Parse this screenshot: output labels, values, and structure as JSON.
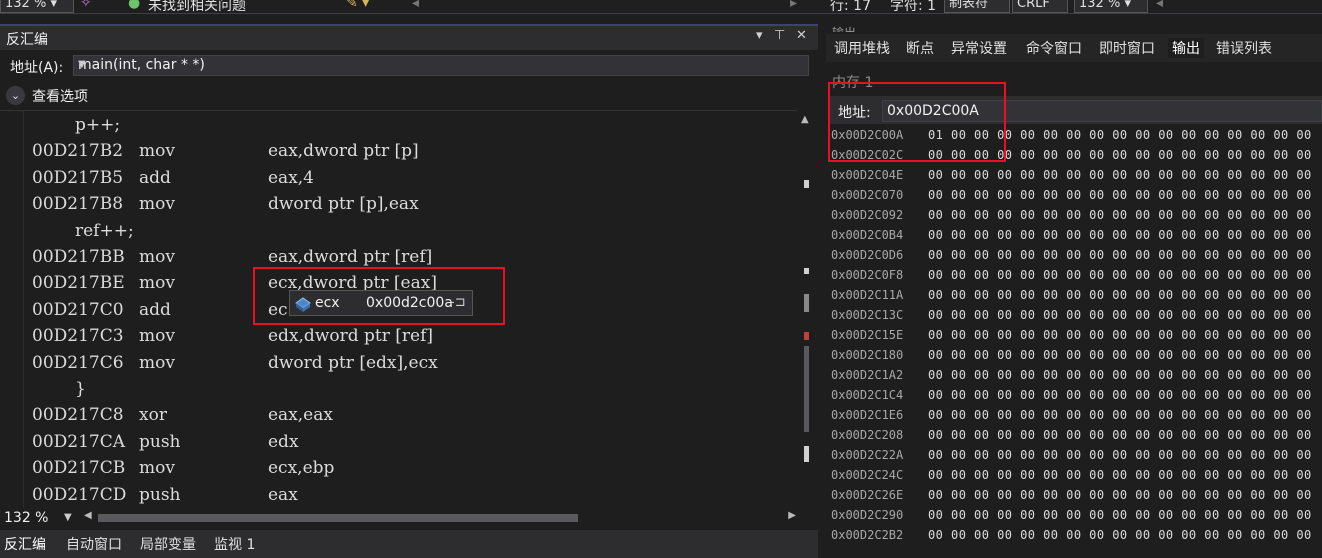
{
  "topbar": {
    "zoom": "132 %",
    "status": "未找到相关问题",
    "line": "行: 17",
    "char": "字符: 1",
    "tabs": "制表符",
    "eol": "CRLF",
    "zoom_right": "132 %"
  },
  "disasm": {
    "title": "反汇编",
    "address_label": "地址(A):",
    "address_value": "main(int, char * *)",
    "view_options": "查看选项",
    "tooltip": {
      "name": "ecx",
      "value": "0x00d2c00a"
    },
    "zoom": "132 %"
  },
  "code_lines": [
    {
      "src": "p++;"
    },
    {
      "addr": "00D217B2",
      "mn": "mov",
      "op": "eax,dword ptr [p]"
    },
    {
      "addr": "00D217B5",
      "mn": "add",
      "op": "eax,4"
    },
    {
      "addr": "00D217B8",
      "mn": "mov",
      "op": "dword ptr [p],eax"
    },
    {
      "src": "ref++;"
    },
    {
      "addr": "00D217BB",
      "mn": "mov",
      "op": "eax,dword ptr [ref]"
    },
    {
      "addr": "00D217BE",
      "mn": "mov",
      "op": "ecx,dword ptr [eax]"
    },
    {
      "addr": "00D217C0",
      "mn": "add",
      "op": "ec"
    },
    {
      "addr": "00D217C3",
      "mn": "mov",
      "op": "edx,dword ptr [ref]"
    },
    {
      "addr": "00D217C6",
      "mn": "mov",
      "op": "dword ptr [edx],ecx"
    },
    {
      "src": "}"
    },
    {
      "addr": "00D217C8",
      "mn": "xor",
      "op": "eax,eax"
    },
    {
      "addr": "00D217CA",
      "mn": "push",
      "op": "edx"
    },
    {
      "addr": "00D217CB",
      "mn": "mov",
      "op": "ecx,ebp"
    },
    {
      "addr": "00D217CD",
      "mn": "push",
      "op": "eax"
    }
  ],
  "bottom_tabs": [
    "反汇编",
    "自动窗口",
    "局部变量",
    "监视 1"
  ],
  "right_tabs": [
    "调用堆栈",
    "断点",
    "异常设置",
    "命令窗口",
    "即时窗口",
    "输出",
    "错误列表"
  ],
  "right_header_partial": "输出",
  "memory": {
    "title": "内存 1",
    "address_label": "地址:",
    "address_value": "0x00D2C00A",
    "first_row_bytes": "01 00 00 00 00 00 00 00 00 00 00 00 00 00 00 00 00",
    "zero_bytes": "00 00 00 00 00 00 00 00 00 00 00 00 00 00 00 00 00",
    "rows": [
      "0x00D2C00A",
      "0x00D2C02C",
      "0x00D2C04E",
      "0x00D2C070",
      "0x00D2C092",
      "0x00D2C0B4",
      "0x00D2C0D6",
      "0x00D2C0F8",
      "0x00D2C11A",
      "0x00D2C13C",
      "0x00D2C15E",
      "0x00D2C180",
      "0x00D2C1A2",
      "0x00D2C1C4",
      "0x00D2C1E6",
      "0x00D2C208",
      "0x00D2C22A",
      "0x00D2C24C",
      "0x00D2C26E",
      "0x00D2C290",
      "0x00D2C2B2"
    ]
  },
  "colors": {
    "highlight_box": "#e81123",
    "accent": "#3e3e84"
  }
}
